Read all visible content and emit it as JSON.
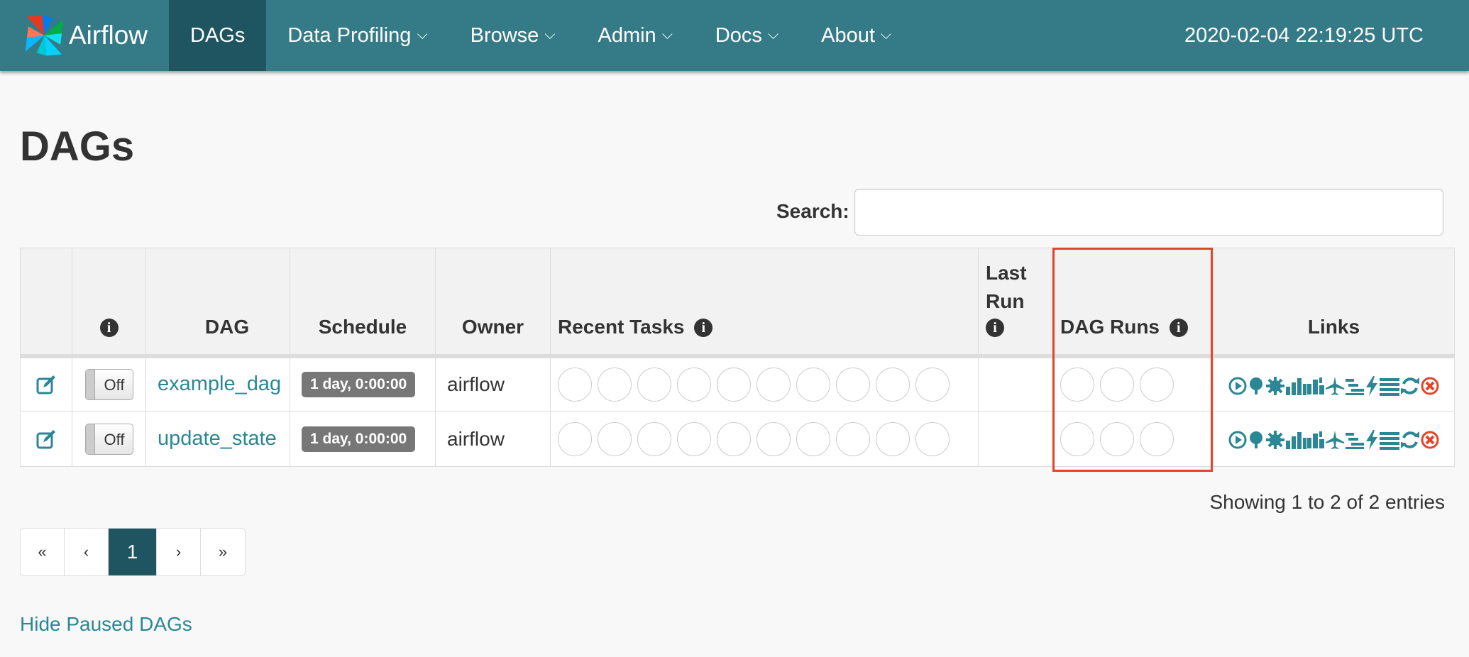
{
  "navbar": {
    "brand": "Airflow",
    "items": [
      {
        "label": "DAGs",
        "active": true
      },
      {
        "label": "Data Profiling"
      },
      {
        "label": "Browse"
      },
      {
        "label": "Admin"
      },
      {
        "label": "Docs"
      },
      {
        "label": "About"
      }
    ],
    "clock": "2020-02-04 22:19:25 UTC"
  },
  "page": {
    "title": "DAGs",
    "search_label": "Search:",
    "search_value": ""
  },
  "table": {
    "headers": {
      "dag": "DAG",
      "schedule": "Schedule",
      "owner": "Owner",
      "recent_tasks": "Recent Tasks",
      "last_run": "Last Run",
      "dag_runs": "DAG Runs",
      "links": "Links"
    },
    "rows": [
      {
        "dag": "example_dag",
        "toggle": "Off",
        "schedule": "1 day, 0:00:00",
        "owner": "airflow"
      },
      {
        "dag": "update_state",
        "toggle": "Off",
        "schedule": "1 day, 0:00:00",
        "owner": "airflow"
      }
    ],
    "info_glyph": "i"
  },
  "footer": {
    "showing": "Showing 1 to 2 of 2 entries",
    "pagination": {
      "first": "«",
      "prev": "‹",
      "current": "1",
      "next": "›",
      "last": "»"
    },
    "hide_paused": "Hide Paused DAGs"
  },
  "colors": {
    "navbar": "#347a87",
    "nav_active": "#1f5560",
    "link": "#2b8794",
    "highlight": "#e4442b",
    "delete_icon": "#e4442b"
  }
}
